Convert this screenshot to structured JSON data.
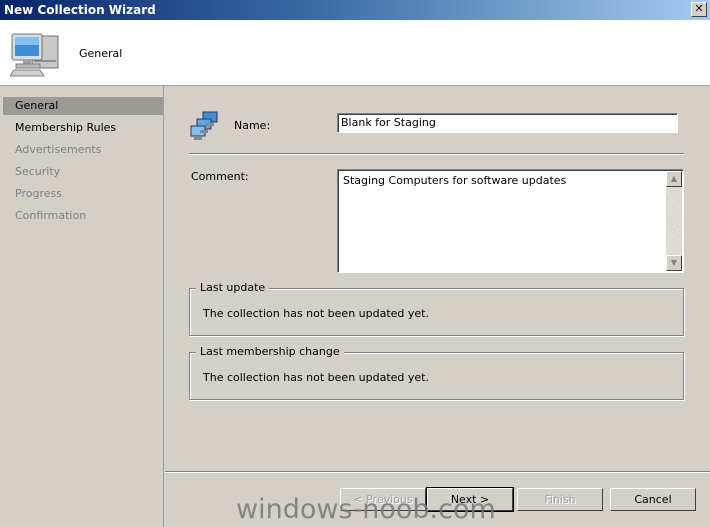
{
  "window": {
    "title": "New Collection Wizard",
    "close_glyph": "✕"
  },
  "header": {
    "title": "General",
    "icon": "computer-icon"
  },
  "nav": {
    "items": [
      {
        "label": "General"
      },
      {
        "label": "Membership Rules"
      },
      {
        "label": "Advertisements"
      },
      {
        "label": "Security"
      },
      {
        "label": "Progress"
      },
      {
        "label": "Confirmation"
      }
    ]
  },
  "form": {
    "name_label": "Name:",
    "name_value": "Blank for Staging",
    "comment_label": "Comment:",
    "comment_value": "Staging Computers for software updates",
    "last_update": {
      "legend": "Last update",
      "text": "The collection has not been updated yet."
    },
    "last_membership_change": {
      "legend": "Last membership change",
      "text": "The collection has not been updated yet."
    }
  },
  "buttons": {
    "previous": "< Previous",
    "next": "Next >",
    "finish": "Finish",
    "cancel": "Cancel"
  },
  "watermark": "windows-noob.com"
}
